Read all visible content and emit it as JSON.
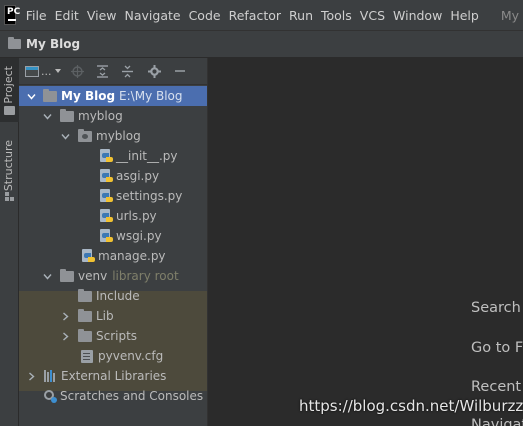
{
  "menu": {
    "logo_text": "PC",
    "items": [
      "File",
      "Edit",
      "View",
      "Navigate",
      "Code",
      "Refactor",
      "Run",
      "Tools",
      "VCS",
      "Window",
      "Help"
    ],
    "trailing": "My"
  },
  "navbar": {
    "title": "My Blog"
  },
  "toolstrip": {
    "project_tab": "Project",
    "structure_tab": "Structure"
  },
  "panel": {
    "view_label": "...",
    "tree": {
      "root": {
        "name": "My Blog",
        "path": "E:\\My Blog"
      },
      "myblog_outer": "myblog",
      "myblog_inner": "myblog",
      "files": [
        "__init__.py",
        "asgi.py",
        "settings.py",
        "urls.py",
        "wsgi.py"
      ],
      "manage": "manage.py",
      "venv": {
        "name": "venv",
        "hint": "library root"
      },
      "venv_children": [
        "Include",
        "Lib",
        "Scripts"
      ],
      "pyvenv": "pyvenv.cfg",
      "external_libraries": "External Libraries",
      "scratches": "Scratches and Consoles"
    }
  },
  "editor": {
    "hints": [
      "Search",
      "Go to Fi",
      "Recent",
      "Navigat"
    ]
  },
  "watermark": "https://blog.csdn.net/Wilburzzz",
  "colors": {
    "selection": "#4b6eaf",
    "excluded_bg": "#4d4a3c",
    "panel_bg": "#3c3f41",
    "editor_bg": "#2b2b2b"
  }
}
